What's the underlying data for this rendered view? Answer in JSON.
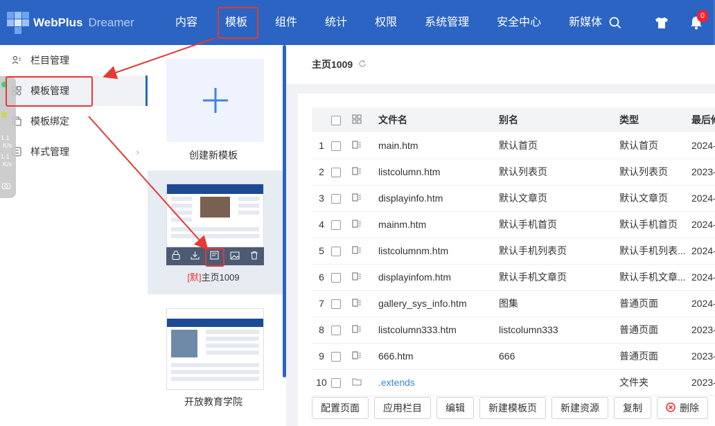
{
  "header": {
    "logo_text": "WebPlus",
    "logo_sub": "Dreamer",
    "nav": [
      {
        "label": "内容",
        "name": "nav-content"
      },
      {
        "label": "模板",
        "name": "nav-template"
      },
      {
        "label": "组件",
        "name": "nav-components"
      },
      {
        "label": "统计",
        "name": "nav-stats"
      },
      {
        "label": "权限",
        "name": "nav-permissions"
      },
      {
        "label": "系统管理",
        "name": "nav-system"
      },
      {
        "label": "安全中心",
        "name": "nav-security"
      },
      {
        "label": "新媒体",
        "name": "nav-newmedia"
      }
    ],
    "notification_count": "0"
  },
  "sidebar": {
    "items": [
      {
        "label": "栏目管理",
        "icon": "column-icon"
      },
      {
        "label": "模板管理",
        "icon": "template-grid-icon"
      },
      {
        "label": "模板绑定",
        "icon": "binding-icon"
      },
      {
        "label": "样式管理",
        "icon": "style-icon"
      }
    ],
    "widget_speed1": "1.1",
    "widget_speed1_unit": "K/s",
    "widget_speed2": "1.1",
    "widget_speed2_unit": "K/s"
  },
  "templates": {
    "create_label": "创建新模板",
    "default_tag": "[默]",
    "selected_name": "主页1009",
    "second_name": "开放教育学院"
  },
  "main": {
    "title": "主页1009",
    "columns": [
      "文件名",
      "别名",
      "类型",
      "最后修"
    ],
    "rows": [
      {
        "n": "1",
        "file": "main.htm",
        "alias": "默认首页",
        "type": "默认首页",
        "date": "2024-"
      },
      {
        "n": "2",
        "file": "listcolumn.htm",
        "alias": "默认列表页",
        "type": "默认列表页",
        "date": "2023-"
      },
      {
        "n": "3",
        "file": "displayinfo.htm",
        "alias": "默认文章页",
        "type": "默认文章页",
        "date": "2024-"
      },
      {
        "n": "4",
        "file": "mainm.htm",
        "alias": "默认手机首页",
        "type": "默认手机首页",
        "date": "2024-"
      },
      {
        "n": "5",
        "file": "listcolumnm.htm",
        "alias": "默认手机列表页",
        "type": "默认手机列表...",
        "date": "2024-"
      },
      {
        "n": "6",
        "file": "displayinfom.htm",
        "alias": "默认手机文章页",
        "type": "默认手机文章...",
        "date": "2024-"
      },
      {
        "n": "7",
        "file": "gallery_sys_info.htm",
        "alias": "图集",
        "type": "普通页面",
        "date": "2024-"
      },
      {
        "n": "8",
        "file": "listcolumn333.htm",
        "alias": "listcolumn333",
        "type": "普通页面",
        "date": "2023-"
      },
      {
        "n": "9",
        "file": "666.htm",
        "alias": "666",
        "type": "普通页面",
        "date": "2023-"
      },
      {
        "n": "10",
        "file": ".extends",
        "alias": "",
        "type": "文件夹",
        "date": "2023-"
      }
    ],
    "buttons": [
      "配置页面",
      "应用栏目",
      "编辑",
      "新建模板页",
      "新建资源",
      "复制",
      "删除"
    ]
  }
}
